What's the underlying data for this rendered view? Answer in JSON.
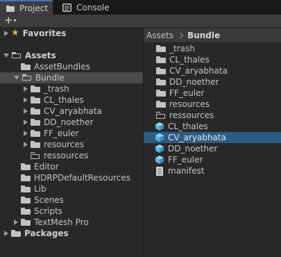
{
  "tabs": {
    "project_label": "Project",
    "console_label": "Console"
  },
  "toolbar": {
    "add_label": "+",
    "add_caret": "▾"
  },
  "tree": {
    "favorites": "Favorites",
    "assets": "Assets",
    "asset_bundles": "AssetBundles",
    "bundle": "Bundle",
    "bundle_children": [
      "_trash",
      "CL_thales",
      "CV_aryabhata",
      "DD_noether",
      "FF_euler",
      "resources",
      "ressources"
    ],
    "editor": "Editor",
    "hdrp": "HDRPDefaultResources",
    "lib": "Lib",
    "scenes": "Scenes",
    "scripts": "Scripts",
    "textmesh": "TextMesh Pro",
    "packages": "Packages"
  },
  "breadcrumb": {
    "root": "Assets",
    "current": "Bundle"
  },
  "files": {
    "folders": [
      "_trash",
      "CL_thales",
      "CV_aryabhata",
      "DD_noether",
      "FF_euler",
      "resources",
      "ressources"
    ],
    "bundles": [
      "CL_thales",
      "CV_aryabhata",
      "DD_noether",
      "FF_euler"
    ],
    "manifest": "manifest"
  },
  "colors": {
    "selection_blue": "#2c5d87",
    "tab_accent": "#3a79bb",
    "cube_blue": "#5bb3e8",
    "star": "#e9b52c"
  }
}
